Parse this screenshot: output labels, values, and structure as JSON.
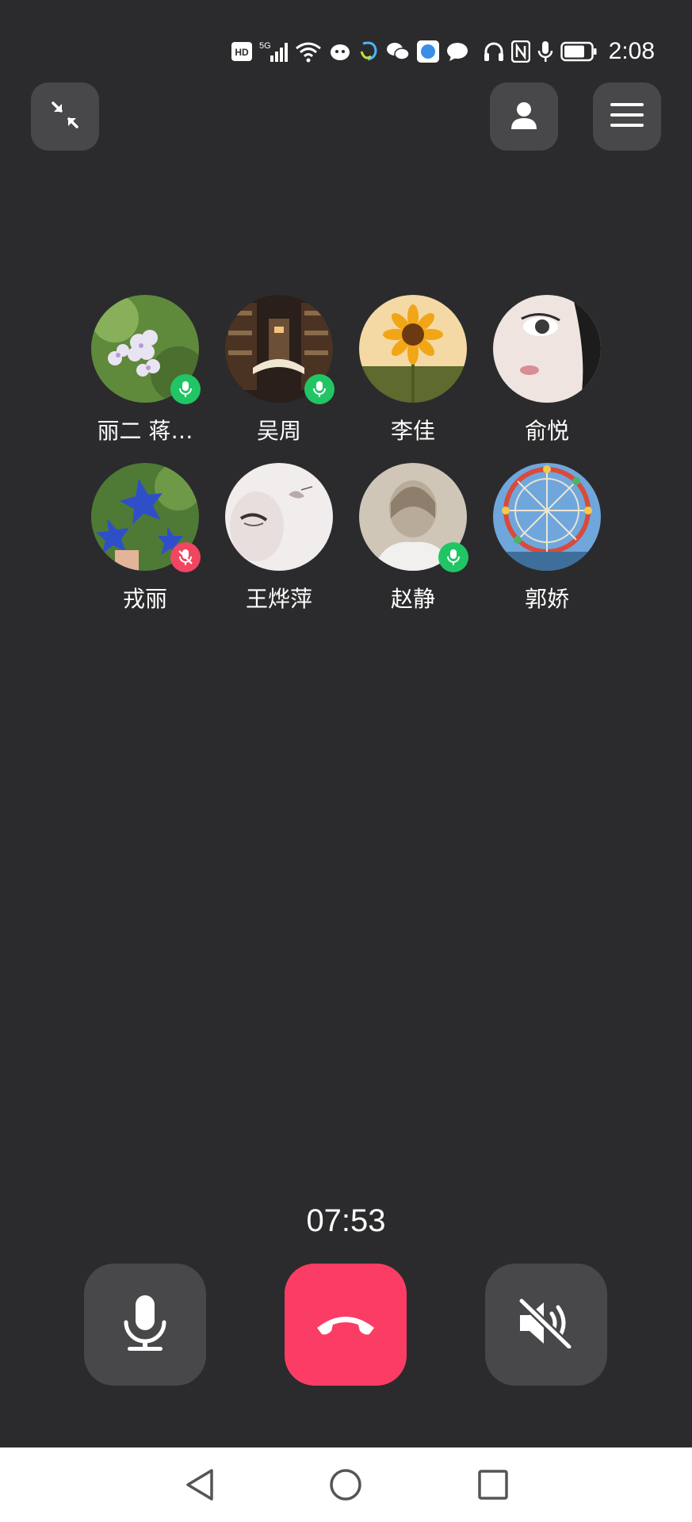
{
  "status_bar": {
    "time": "2:08",
    "hd_label": "HD",
    "network_label": "5G",
    "icons": [
      "hd-icon",
      "signal-icon",
      "wifi-icon",
      "app-notification-icon",
      "app-notification-icon",
      "wechat-icon",
      "browser-icon",
      "message-icon",
      "headphones-icon",
      "nfc-icon",
      "microphone-icon",
      "battery-icon"
    ]
  },
  "top_controls": {
    "minimize_icon": "minimize-arrows-icon",
    "contacts_icon": "person-icon",
    "menu_icon": "hamburger-menu-icon"
  },
  "participants": [
    {
      "name": "丽二 蒋…",
      "mic": "on",
      "avatar_theme": "white-flowers"
    },
    {
      "name": "吴周",
      "mic": "on",
      "avatar_theme": "library-book"
    },
    {
      "name": "李佳",
      "mic": "none",
      "avatar_theme": "sunflower"
    },
    {
      "name": "俞悦",
      "mic": "none",
      "avatar_theme": "face-closeup"
    },
    {
      "name": "戎丽",
      "mic": "off",
      "avatar_theme": "blue-flowers"
    },
    {
      "name": "王烨萍",
      "mic": "none",
      "avatar_theme": "pale-face"
    },
    {
      "name": "赵静",
      "mic": "on",
      "avatar_theme": "blurred-person"
    },
    {
      "name": "郭娇",
      "mic": "none",
      "avatar_theme": "ferris-wheel"
    }
  ],
  "call": {
    "duration": "07:53",
    "mic_icon": "microphone-icon",
    "hangup_icon": "hang-up-phone-icon",
    "speaker_icon": "speaker-muted-icon"
  },
  "nav_bar": {
    "back_icon": "back-triangle-icon",
    "home_icon": "home-circle-icon",
    "recent_icon": "recent-apps-square-icon"
  },
  "colors": {
    "background": "#2b2b2d",
    "button_gray": "#48484a",
    "hangup_red": "#fb3d65",
    "mic_on_green": "#22c565",
    "mic_off_red": "#f04662"
  }
}
